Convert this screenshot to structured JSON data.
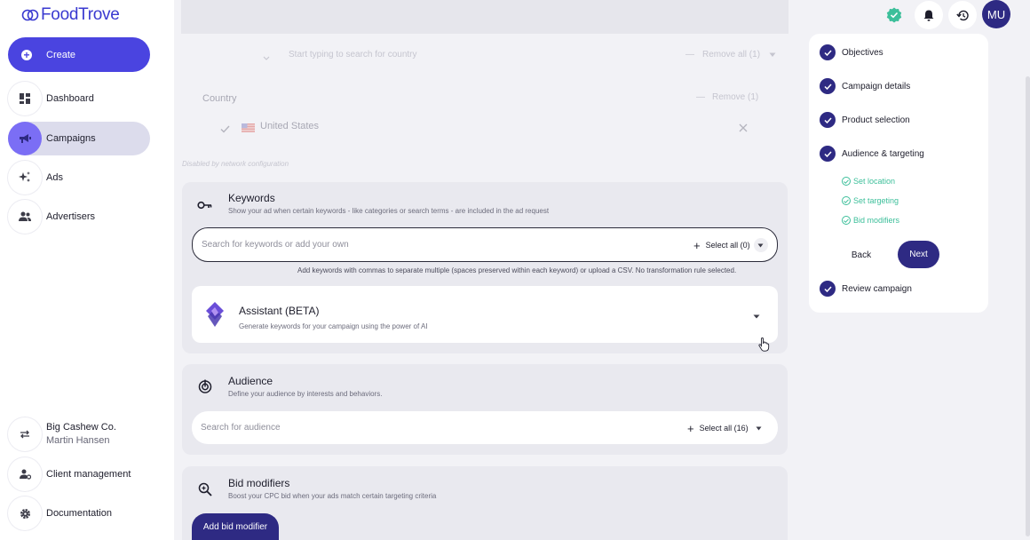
{
  "brand": {
    "name": "FoodTrove",
    "color": "#3a3ad0"
  },
  "sidebar": {
    "create_label": "Create",
    "items": [
      {
        "label": "Dashboard",
        "icon": "dashboard-icon"
      },
      {
        "label": "Campaigns",
        "icon": "megaphone-icon",
        "active": true
      },
      {
        "label": "Ads",
        "icon": "sparkle-icon"
      },
      {
        "label": "Advertisers",
        "icon": "people-icon"
      }
    ],
    "account": {
      "company": "Big Cashew Co.",
      "user": "Martin Hansen"
    },
    "client_management": "Client management",
    "documentation": "Documentation"
  },
  "topbar": {
    "avatar_initials": "MU"
  },
  "country": {
    "search_placeholder": "Start typing to search for country",
    "remove_all": "Remove all (1)",
    "label": "Country",
    "remove": "Remove (1)",
    "selected": "United States",
    "disabled_note": "Disabled by network configuration"
  },
  "keywords": {
    "title": "Keywords",
    "description": "Show your ad when certain keywords - like categories or search terms - are included in the ad request",
    "placeholder": "Search for keywords or add your own",
    "select_all": "Select all (0)",
    "helper": "Add keywords with commas to separate multiple (spaces preserved within each keyword) or upload a CSV. No transformation rule selected.",
    "assistant_title": "Assistant (BETA)",
    "assistant_desc": "Generate keywords for your campaign using the power of AI"
  },
  "audience": {
    "title": "Audience",
    "description": "Define your audience by interests and behaviors.",
    "placeholder": "Search for audience",
    "select_all": "Select all (16)"
  },
  "bid_modifiers": {
    "title": "Bid modifiers",
    "description": "Boost your CPC bid when your ads match certain targeting criteria",
    "button": "Add bid modifier"
  },
  "stepper": {
    "steps": [
      "Objectives",
      "Campaign details",
      "Product selection",
      "Audience & targeting"
    ],
    "sub_steps": [
      "Set location",
      "Set targeting",
      "Bid modifiers"
    ],
    "back": "Back",
    "next": "Next",
    "final_step": "Review campaign"
  },
  "colors": {
    "primary": "#4a44e0",
    "dark": "#2e2a83",
    "success": "#3cbf9a"
  }
}
